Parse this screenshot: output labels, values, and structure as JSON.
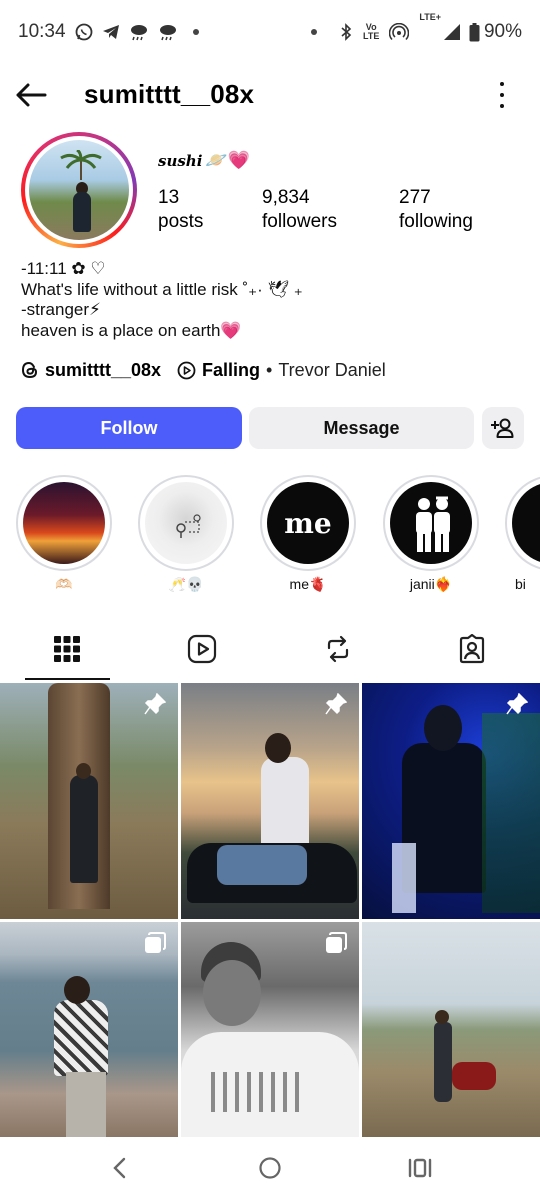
{
  "status_bar": {
    "time": "10:34",
    "battery": "90%",
    "network_label": "LTE+",
    "volte_label_top": "Vo",
    "volte_label_bottom": "LTE"
  },
  "header": {
    "username": "sumitttt__08x"
  },
  "profile": {
    "display_name": "sushi",
    "display_name_emoji": "🪐💗",
    "stats": [
      {
        "value": "13",
        "label": "posts"
      },
      {
        "value": "9,834",
        "label": "followers"
      },
      {
        "value": "277",
        "label": "following"
      }
    ],
    "bio_lines": [
      "-11:11 ✿ ♡",
      "What's life without a little risk ˚₊· 🕊 ₊",
      "-stranger⚡",
      "heaven is a place on earth💗"
    ],
    "threads_handle": "sumitttt__08x",
    "music_title": "Falling",
    "music_separator": "•",
    "music_artist": "Trevor Daniel"
  },
  "actions": {
    "follow_label": "Follow",
    "message_label": "Message"
  },
  "highlights": [
    {
      "label": "🫶🏻"
    },
    {
      "label": "🥂💀"
    },
    {
      "label": "me🫀",
      "cover_text": "me"
    },
    {
      "label": "janii❤️‍🔥"
    },
    {
      "label": "bi"
    }
  ],
  "tabs": [
    {
      "name": "grid",
      "icon": "grid-icon",
      "active": true
    },
    {
      "name": "reels",
      "icon": "reels-icon",
      "active": false
    },
    {
      "name": "reposts",
      "icon": "repost-icon",
      "active": false
    },
    {
      "name": "tagged",
      "icon": "tagged-icon",
      "active": false
    }
  ],
  "posts": [
    {
      "badge": "pin-icon"
    },
    {
      "badge": "pin-icon"
    },
    {
      "badge": "pin-icon"
    },
    {
      "badge": "carousel-icon"
    },
    {
      "badge": "carousel-icon"
    },
    {
      "badge": "none"
    }
  ],
  "colors": {
    "follow_button": "#4c5dfa",
    "secondary_button": "#efeff1"
  }
}
